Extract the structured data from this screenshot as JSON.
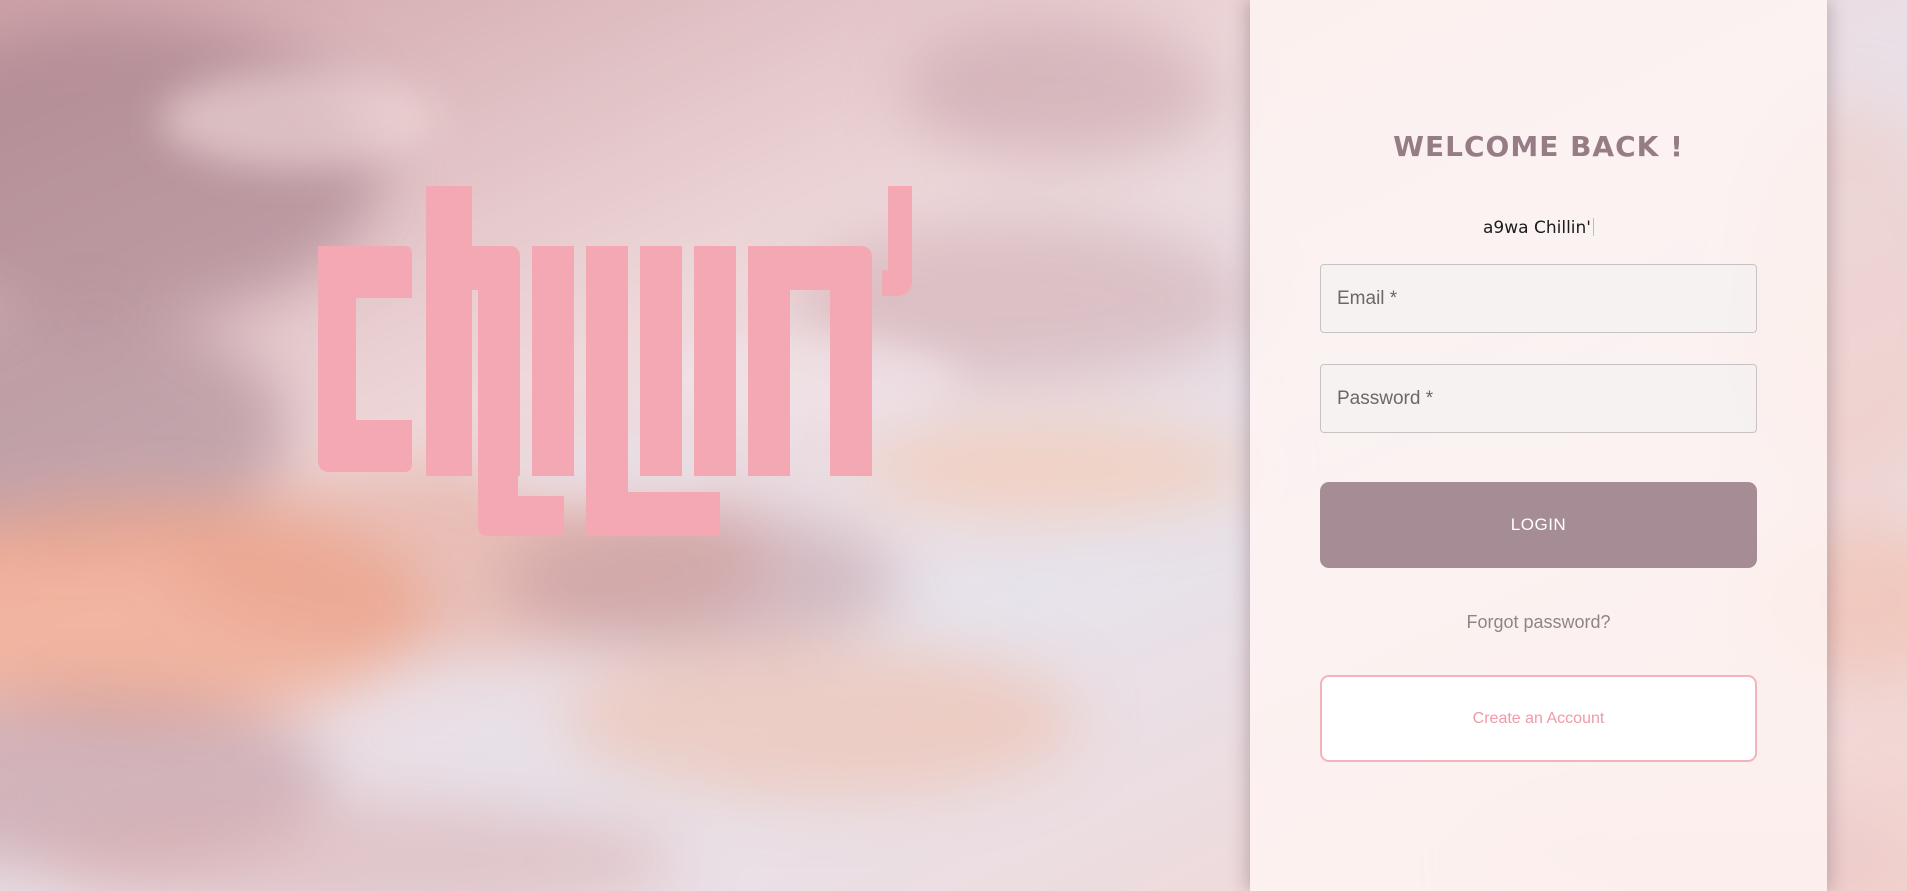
{
  "brand": {
    "logo_text": "CHILLIN'",
    "logo_color": "#f3a8b3"
  },
  "login_panel": {
    "title": "WELCOME BACK !",
    "subtitle": "a9wa Chillin'",
    "email_placeholder": "Email *",
    "email_value": "",
    "password_placeholder": "Password *",
    "password_value": "",
    "login_label": "LOGIN",
    "forgot_label": "Forgot password?",
    "create_account_label": "Create an Account"
  },
  "colors": {
    "accent": "#a68c94",
    "title": "#957c85",
    "pink": "#f3a8b3",
    "create_border": "#f3b3bd",
    "create_text": "#f199a9"
  }
}
